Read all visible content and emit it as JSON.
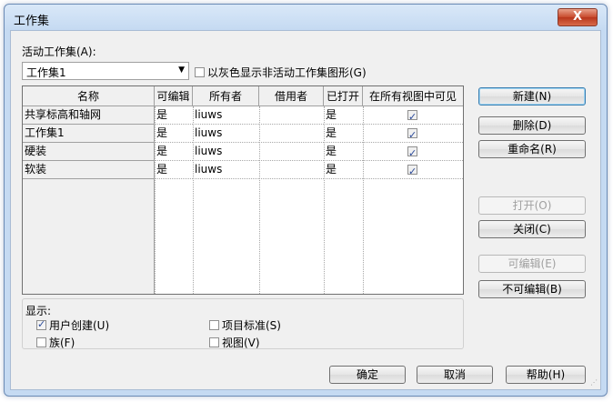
{
  "window": {
    "title": "工作集",
    "close_symbol": "X"
  },
  "active_workset": {
    "label": "活动工作集(A):",
    "selected": "工作集1",
    "gray_option_label": "以灰色显示非活动工作集图形(G)",
    "gray_option_checked": false
  },
  "table": {
    "columns": [
      "名称",
      "可编辑",
      "所有者",
      "借用者",
      "已打开",
      "在所有视图中可见"
    ],
    "rows": [
      {
        "name": "共享标高和轴网",
        "editable": "是",
        "owner": "liuws",
        "borrowers": "",
        "opened": "是",
        "visible_all_views": true
      },
      {
        "name": "工作集1",
        "editable": "是",
        "owner": "liuws",
        "borrowers": "",
        "opened": "是",
        "visible_all_views": true
      },
      {
        "name": "硬装",
        "editable": "是",
        "owner": "liuws",
        "borrowers": "",
        "opened": "是",
        "visible_all_views": true
      },
      {
        "name": "软装",
        "editable": "是",
        "owner": "liuws",
        "borrowers": "",
        "opened": "是",
        "visible_all_views": true
      }
    ]
  },
  "side_buttons": {
    "new": "新建(N)",
    "delete": "删除(D)",
    "rename": "重命名(R)",
    "open": "打开(O)",
    "close": "关闭(C)",
    "editable": "可编辑(E)",
    "non_editable": "不可编辑(B)"
  },
  "show": {
    "label": "显示:",
    "user_created": {
      "label": "用户创建(U)",
      "checked": true
    },
    "project_standards": {
      "label": "项目标准(S)",
      "checked": false
    },
    "families": {
      "label": "族(F)",
      "checked": false
    },
    "views": {
      "label": "视图(V)",
      "checked": false
    }
  },
  "footer": {
    "ok": "确定",
    "cancel": "取消",
    "help": "帮助(H)"
  }
}
